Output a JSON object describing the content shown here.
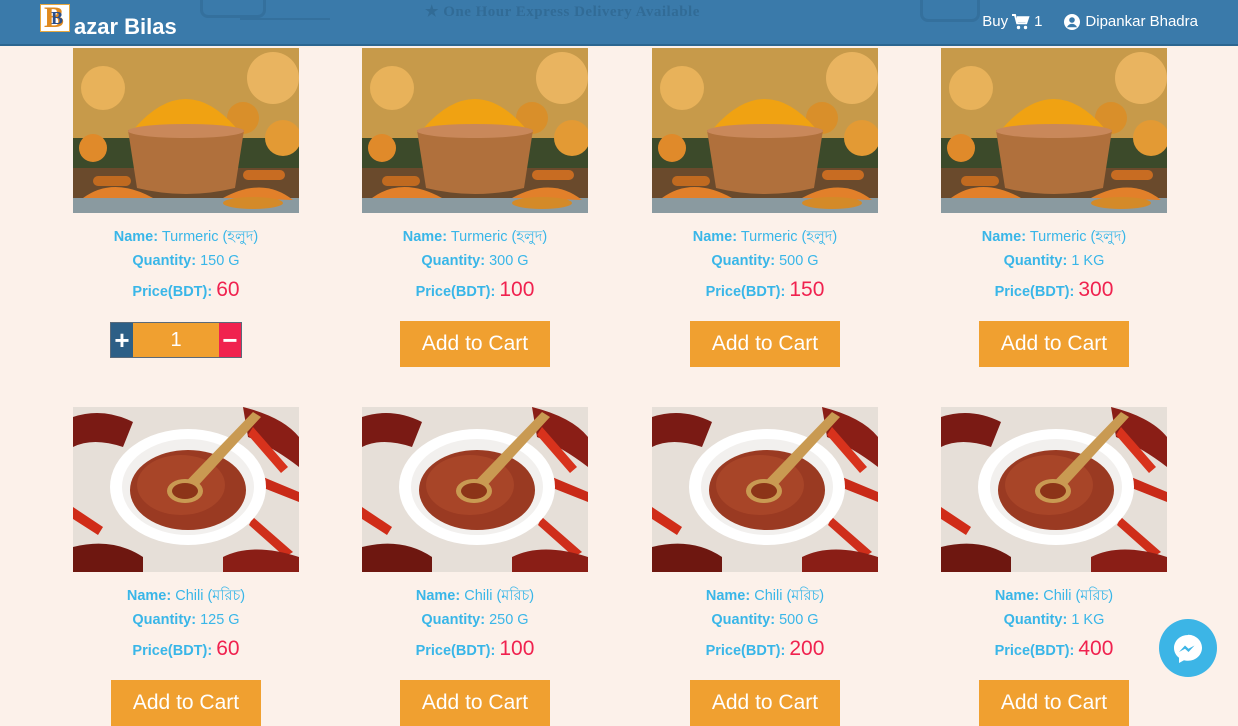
{
  "header": {
    "brand_letter": "B",
    "brand_text": "azar Bilas",
    "tagline": "★ One Hour Express Delivery Available",
    "buy_label": "Buy",
    "cart_count": "1",
    "user_name": "Dipankar Bhadra",
    "icons": [
      "cart-icon",
      "user-circle-icon"
    ]
  },
  "labels": {
    "name": "Name:",
    "quantity": "Quantity:",
    "price": "Price(BDT):",
    "add_to_cart": "Add to Cart"
  },
  "products": [
    {
      "name": "Turmeric (হলুদ)",
      "quantity": "150 G",
      "price": "60",
      "in_cart": true,
      "qty": "1"
    },
    {
      "name": "Turmeric (হলুদ)",
      "quantity": "300 G",
      "price": "100",
      "in_cart": false
    },
    {
      "name": "Turmeric (হলুদ)",
      "quantity": "500 G",
      "price": "150",
      "in_cart": false
    },
    {
      "name": "Turmeric (হলুদ)",
      "quantity": "1 KG",
      "price": "300",
      "in_cart": false
    },
    {
      "name": "Chili (মরিচ)",
      "quantity": "125 G",
      "price": "60",
      "in_cart": false
    },
    {
      "name": "Chili (মরিচ)",
      "quantity": "250 G",
      "price": "100",
      "in_cart": false
    },
    {
      "name": "Chili (মরিচ)",
      "quantity": "500 G",
      "price": "200",
      "in_cart": false
    },
    {
      "name": "Chili (মরিচ)",
      "quantity": "1 KG",
      "price": "400",
      "in_cart": false
    }
  ],
  "colors": {
    "header_bg": "#3a7aaa",
    "page_bg": "#fcf1ea",
    "label": "#39b6e8",
    "price": "#f0224f",
    "button": "#f0a030",
    "messenger": "#3cb5e6"
  }
}
